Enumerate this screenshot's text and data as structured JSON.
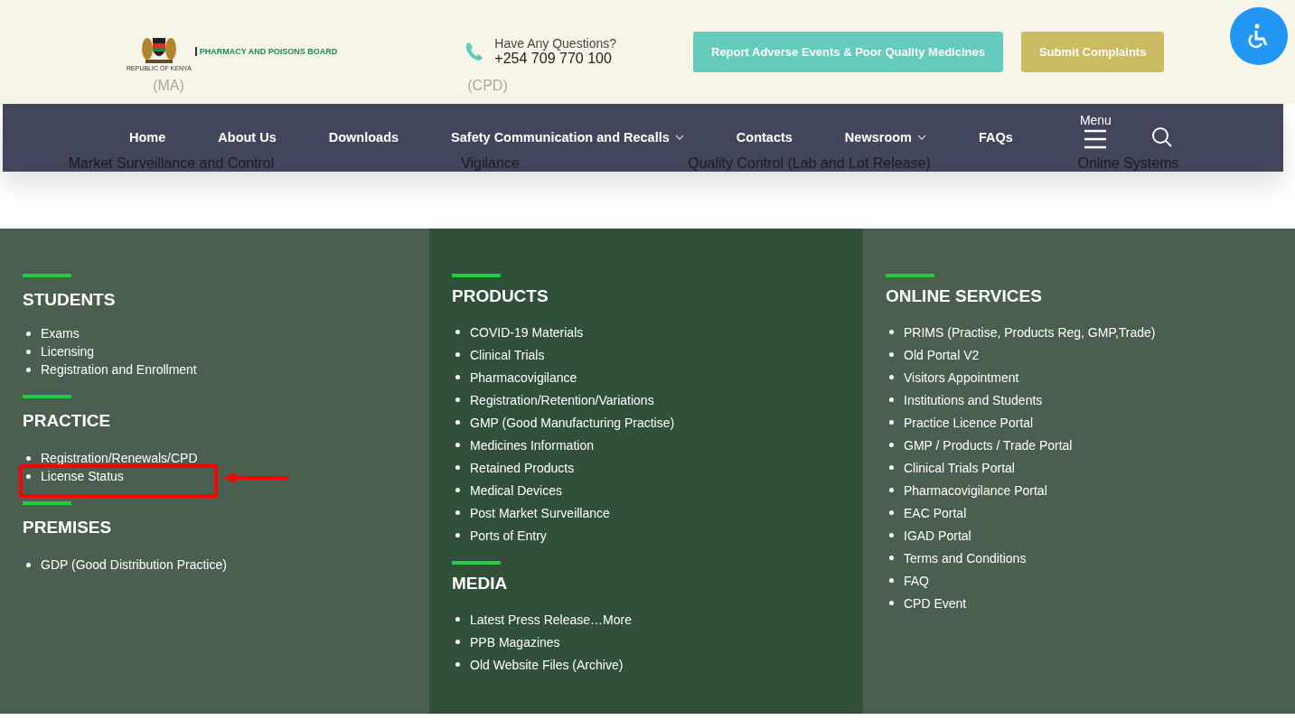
{
  "header": {
    "logo": {
      "name": "PHARMACY AND POISONS BOARD",
      "caption": "REPUBLIC OF KENYA"
    },
    "contact": {
      "question": "Have Any Questions?",
      "phone": "+254 709 770 100"
    },
    "buttons": [
      {
        "label": "Report Adverse Events & Poor Quality Medicines",
        "kind": "report"
      },
      {
        "label": "Submit Complaints",
        "kind": "complaints"
      }
    ],
    "background_links": [
      "(MA)",
      "(CPD)"
    ]
  },
  "nav": {
    "items": [
      {
        "label": "Home",
        "dropdown": false
      },
      {
        "label": "About Us",
        "dropdown": false
      },
      {
        "label": "Downloads",
        "dropdown": false
      },
      {
        "label": "Safety Communication and Recalls",
        "dropdown": true
      },
      {
        "label": "Contacts",
        "dropdown": false
      },
      {
        "label": "Newsroom",
        "dropdown": true
      },
      {
        "label": "FAQs",
        "dropdown": false
      }
    ],
    "menu_label": "Menu",
    "background_links": [
      "Market Surveillance and Control",
      "Vigilance",
      "Quality Control (Lab and Lot Release)",
      "Online Systems"
    ]
  },
  "footer": {
    "columns": [
      {
        "sections": [
          {
            "title": "STUDENTS",
            "items": [
              {
                "label": "Exams",
                "highlighted": false
              },
              {
                "label": "Licensing",
                "highlighted": false
              },
              {
                "label": "Registration and Enrollment",
                "highlighted": false
              }
            ]
          },
          {
            "title": "PRACTICE",
            "items": [
              {
                "label": "Registration/Renewals/CPD",
                "highlighted": false
              },
              {
                "label": "License Status",
                "highlighted": true
              }
            ]
          },
          {
            "title": "PREMISES",
            "items": [
              {
                "label": "GDP (Good Distribution Practice)",
                "highlighted": false
              }
            ]
          }
        ]
      },
      {
        "sections": [
          {
            "title": "PRODUCTS",
            "items": [
              {
                "label": "COVID-19 Materials",
                "highlighted": false
              },
              {
                "label": "Clinical Trials",
                "highlighted": false
              },
              {
                "label": "Pharmacovigilance",
                "highlighted": false
              },
              {
                "label": "Registration/Retention/Variations",
                "highlighted": false
              },
              {
                "label": "GMP (Good Manufacturing Practise)",
                "highlighted": false
              },
              {
                "label": "Medicines Information",
                "highlighted": false
              },
              {
                "label": "Retained Products",
                "highlighted": false
              },
              {
                "label": "Medical Devices",
                "highlighted": false
              },
              {
                "label": "Post Market Surveillance",
                "highlighted": false
              },
              {
                "label": "Ports of Entry",
                "highlighted": false
              }
            ]
          },
          {
            "title": "MEDIA",
            "items": [
              {
                "label": "Latest Press Release…More",
                "highlighted": false
              },
              {
                "label": "PPB Magazines",
                "highlighted": false
              },
              {
                "label": "Old Website Files (Archive)",
                "highlighted": false
              }
            ]
          }
        ]
      },
      {
        "sections": [
          {
            "title": "ONLINE SERVICES",
            "items": [
              {
                "label": "PRIMS (Practise, Products Reg, GMP,Trade)",
                "highlighted": false
              },
              {
                "label": "Old Portal V2",
                "highlighted": false
              },
              {
                "label": "Visitors Appointment",
                "highlighted": false
              },
              {
                "label": "Institutions and Students",
                "highlighted": false
              },
              {
                "label": "Practice Licence Portal",
                "highlighted": false
              },
              {
                "label": "GMP / Products / Trade Portal",
                "highlighted": false
              },
              {
                "label": "Clinical Trials Portal",
                "highlighted": false
              },
              {
                "label": "Pharmacovigilance Portal",
                "highlighted": false
              },
              {
                "label": "EAC Portal",
                "highlighted": false
              },
              {
                "label": "IGAD Portal",
                "highlighted": false
              },
              {
                "label": "Terms and Conditions",
                "highlighted": false
              },
              {
                "label": "FAQ",
                "highlighted": false
              },
              {
                "label": "CPD Event",
                "highlighted": false
              }
            ]
          }
        ]
      }
    ]
  }
}
